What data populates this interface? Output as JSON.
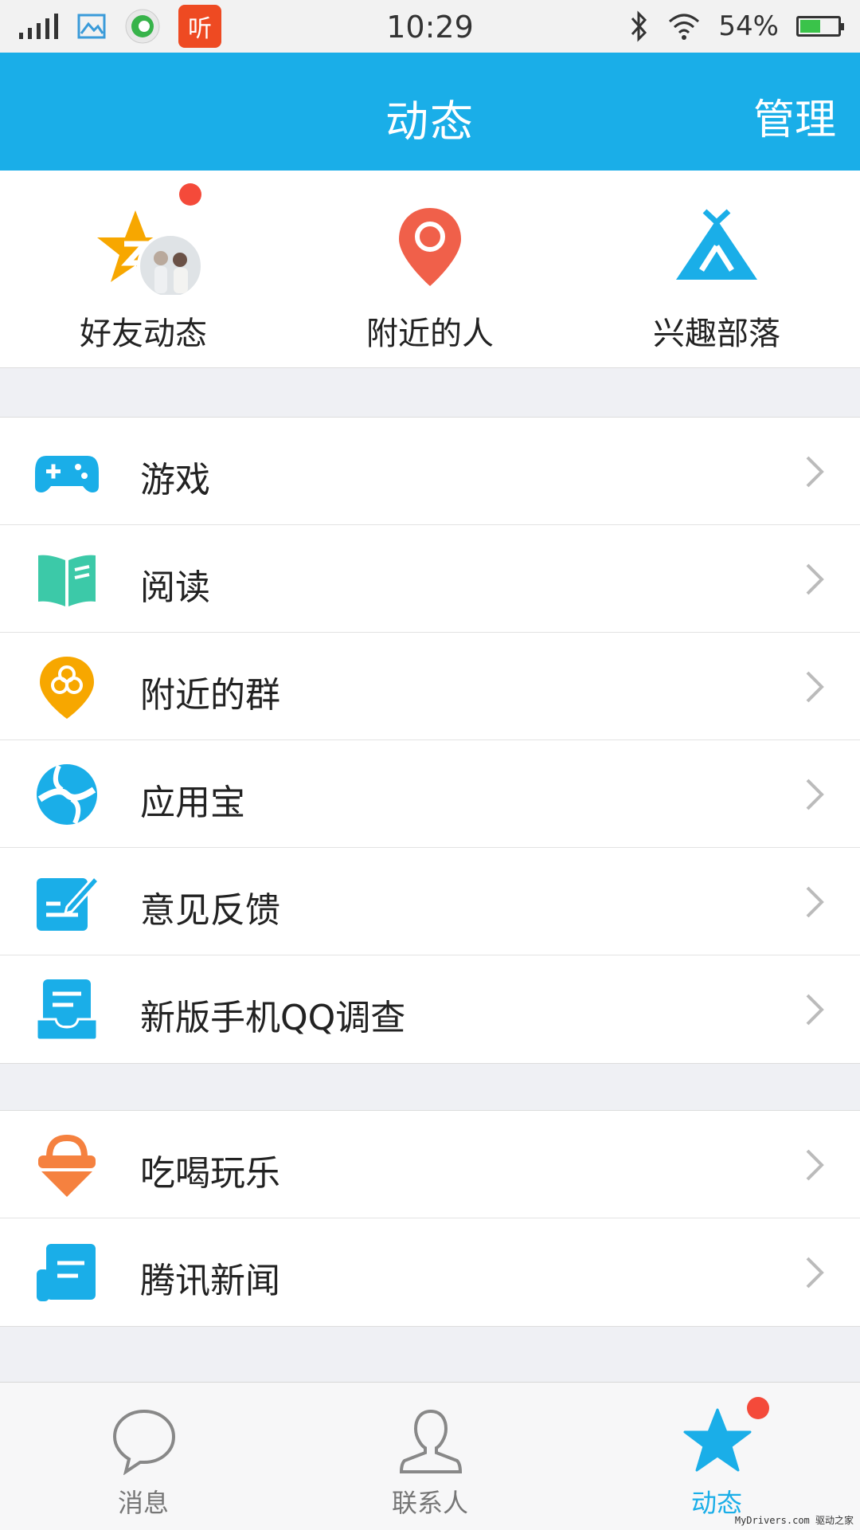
{
  "status_bar": {
    "time": "10:29",
    "battery": "54%",
    "battery_level": 0.54,
    "notification_app_label": "听",
    "icons": [
      "signal-icon",
      "gallery-icon",
      "app-green-icon",
      "ting-app-icon",
      "bluetooth-icon",
      "wifi-icon",
      "battery-icon"
    ]
  },
  "header": {
    "title": "动态",
    "manage_label": "管理"
  },
  "top_entries": [
    {
      "label": "好友动态",
      "icon": "friend-feed-star-icon",
      "has_dot": true
    },
    {
      "label": "附近的人",
      "icon": "location-pin-icon",
      "has_dot": false
    },
    {
      "label": "兴趣部落",
      "icon": "tent-icon",
      "has_dot": false
    }
  ],
  "group1": [
    {
      "label": "游戏",
      "icon": "gamepad-icon"
    },
    {
      "label": "阅读",
      "icon": "book-icon"
    },
    {
      "label": "附近的群",
      "icon": "nearby-group-icon"
    },
    {
      "label": "应用宝",
      "icon": "app-store-icon"
    },
    {
      "label": "意见反馈",
      "icon": "feedback-icon"
    },
    {
      "label": "新版手机QQ调查",
      "icon": "survey-icon"
    }
  ],
  "group2": [
    {
      "label": "吃喝玩乐",
      "icon": "food-fun-icon"
    },
    {
      "label": "腾讯新闻",
      "icon": "news-icon"
    }
  ],
  "bottom_nav": [
    {
      "label": "消息",
      "icon": "chat-bubble-icon",
      "active": false
    },
    {
      "label": "联系人",
      "icon": "contacts-icon",
      "active": false
    },
    {
      "label": "动态",
      "icon": "star-icon",
      "active": true,
      "has_dot": true
    }
  ],
  "colors": {
    "accent": "#1aaee8",
    "red_dot": "#f44a3a",
    "orange": "#f7a700",
    "location_red": "#f0604a",
    "teal": "#3cc9a8"
  },
  "watermark": "MyDrivers.com 驱动之家"
}
